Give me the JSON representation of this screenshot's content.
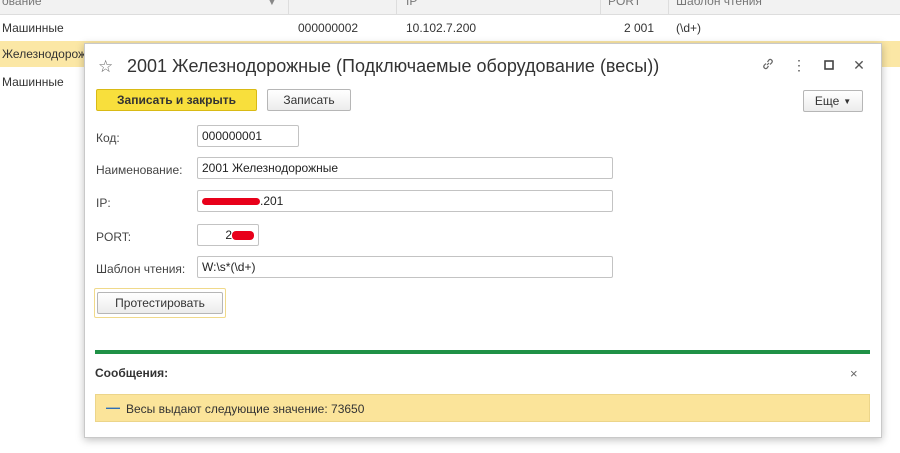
{
  "list": {
    "header": [
      "ование",
      "IP",
      "PORT",
      "Шаблон чтения"
    ],
    "rows": [
      {
        "name": "Машинные",
        "code": "000000002",
        "ip": "10.102.7.200",
        "port": "2 001",
        "template": "(\\d+)"
      },
      {
        "name": "Железнодорож",
        "code": "",
        "ip": "",
        "port": "",
        "template": ""
      },
      {
        "name": "Машинные",
        "code": "",
        "ip": "",
        "port": "",
        "template": ""
      }
    ],
    "colors": {
      "selected_row": "#fbe7a5"
    }
  },
  "dialog": {
    "title": "2001 Железнодорожные (Подключаемые оборудование (весы))",
    "icons": {
      "favorite": "star-icon",
      "link": "link-icon",
      "menu": "more-vertical-icon",
      "maximize": "maximize-icon",
      "close": "close-icon"
    },
    "toolbar": {
      "save_close": "Записать и закрыть",
      "save": "Записать",
      "more": "Еще"
    },
    "fields": {
      "code": {
        "label": "Код:",
        "value": "000000001"
      },
      "name": {
        "label": "Наименование:",
        "value": "2001 Железнодорожные"
      },
      "ip": {
        "label": "IP:",
        "value_visible": ".201"
      },
      "port": {
        "label": "PORT:",
        "value_visible": "2"
      },
      "template": {
        "label": "Шаблон чтения:",
        "value": "W:\\s*(\\d+)"
      }
    },
    "test_button": "Протестировать",
    "messages": {
      "title": "Сообщения:",
      "close": "×",
      "items": [
        "Весы выдают следующие значение: 73650"
      ]
    },
    "colors": {
      "primary_button": "#f8df3c",
      "progress": "#1f9146",
      "message_bg": "#fbe49a"
    }
  }
}
